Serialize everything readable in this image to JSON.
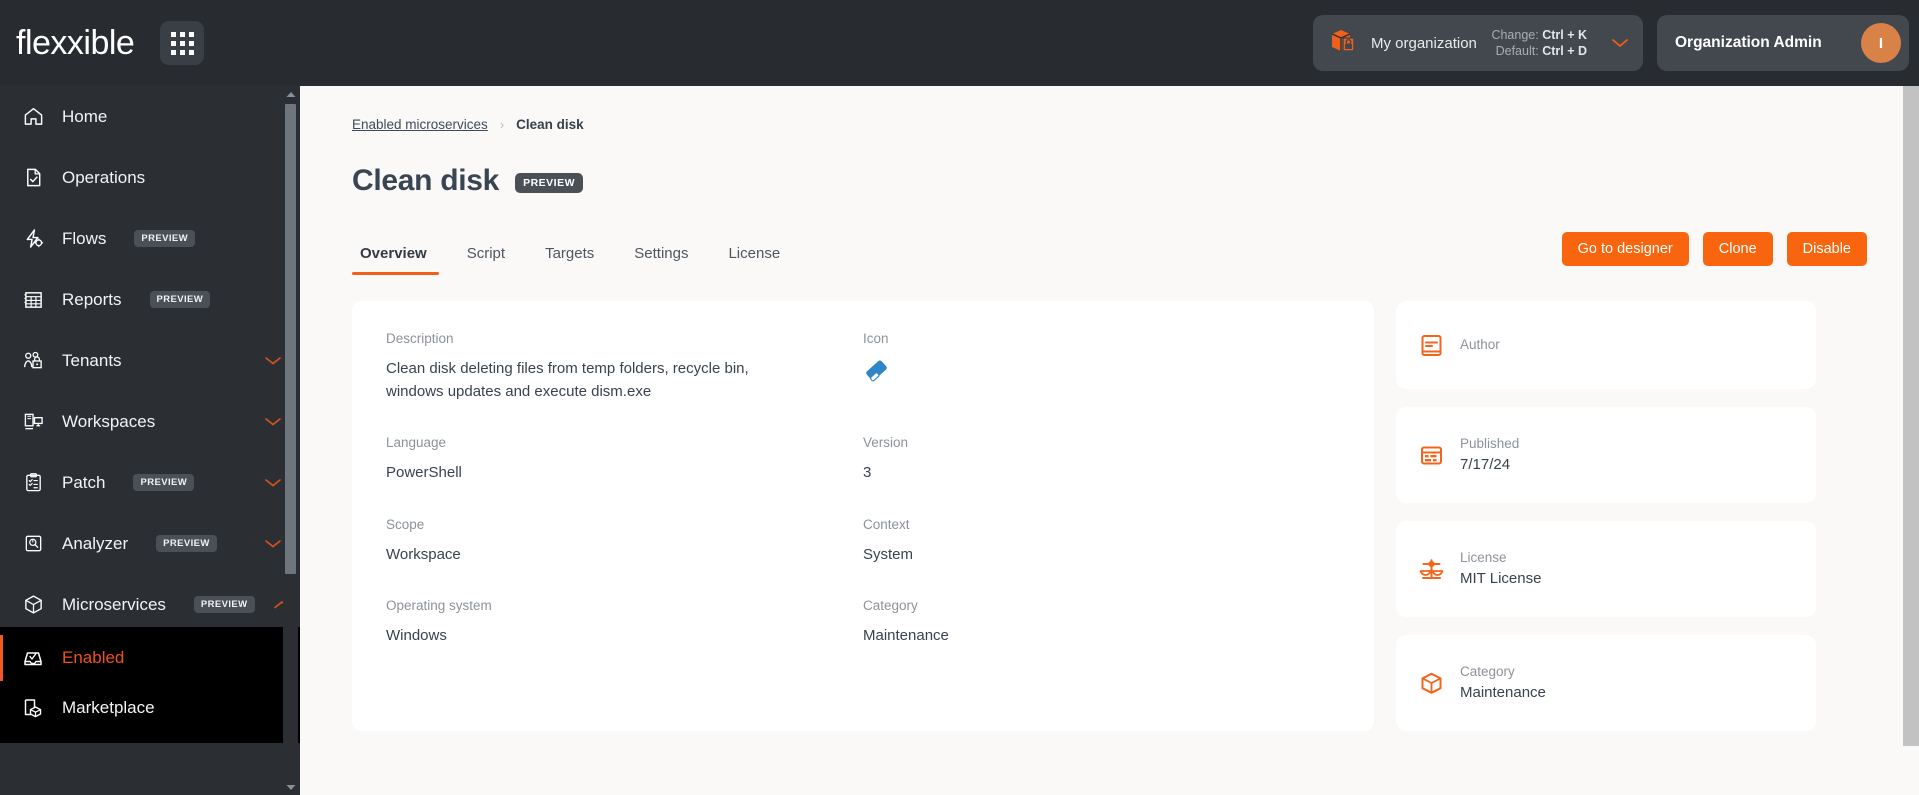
{
  "topbar": {
    "brand": "flexxible",
    "apps_icon": "grid-apps-icon",
    "org": {
      "icon": "package-box-icon",
      "name": "My organization",
      "change_label": "Change:",
      "change_key": "Ctrl + K",
      "default_label": "Default:",
      "default_key": "Ctrl + D",
      "chevron": "chevron-down-icon"
    },
    "user": {
      "role": "Organization Admin",
      "avatar_initial": "I"
    }
  },
  "sidebar": {
    "items": [
      {
        "label": "Home",
        "icon": "home-icon",
        "tag": "",
        "chevron": ""
      },
      {
        "label": "Operations",
        "icon": "document-check-icon",
        "tag": "",
        "chevron": ""
      },
      {
        "label": "Flows",
        "icon": "flow-bolt-icon",
        "tag": "PREVIEW",
        "chevron": ""
      },
      {
        "label": "Reports",
        "icon": "reports-table-icon",
        "tag": "PREVIEW",
        "chevron": ""
      },
      {
        "label": "Tenants",
        "icon": "tenants-users-icon",
        "tag": "",
        "chevron": "chevron-down-icon"
      },
      {
        "label": "Workspaces",
        "icon": "workspaces-icon",
        "tag": "",
        "chevron": "chevron-down-icon"
      },
      {
        "label": "Patch",
        "icon": "patch-clipboard-icon",
        "tag": "PREVIEW",
        "chevron": "chevron-down-icon"
      },
      {
        "label": "Analyzer",
        "icon": "analyzer-disk-icon",
        "tag": "PREVIEW",
        "chevron": "chevron-down-icon"
      },
      {
        "label": "Microservices",
        "icon": "cube-icon",
        "tag": "PREVIEW",
        "chevron": "chevron-up-icon"
      }
    ],
    "submenu": [
      {
        "label": "Enabled",
        "icon": "inbox-check-icon",
        "active": true
      },
      {
        "label": "Marketplace",
        "icon": "page-cube-icon",
        "active": false
      }
    ]
  },
  "main": {
    "breadcrumb": {
      "parent": "Enabled microservices",
      "separator": "›",
      "current": "Clean disk"
    },
    "title": "Clean disk",
    "title_tag": "PREVIEW",
    "tabs": [
      {
        "label": "Overview",
        "active": true
      },
      {
        "label": "Script",
        "active": false
      },
      {
        "label": "Targets",
        "active": false
      },
      {
        "label": "Settings",
        "active": false
      },
      {
        "label": "License",
        "active": false
      }
    ],
    "actions": [
      {
        "label": "Go to designer"
      },
      {
        "label": "Clone"
      },
      {
        "label": "Disable"
      }
    ],
    "fields": [
      {
        "label": "Description",
        "value": "Clean disk deleting files from temp folders, recycle bin, windows updates and execute dism.exe"
      },
      {
        "label": "Icon",
        "value": "",
        "icon": "eraser-icon"
      },
      {
        "label": "Language",
        "value": "PowerShell"
      },
      {
        "label": "Version",
        "value": "3"
      },
      {
        "label": "Scope",
        "value": "Workspace"
      },
      {
        "label": "Context",
        "value": "System"
      },
      {
        "label": "Operating system",
        "value": "Windows"
      },
      {
        "label": "Category",
        "value": "Maintenance"
      }
    ],
    "side_cards": [
      {
        "label": "Author",
        "value": "",
        "icon": "author-book-icon"
      },
      {
        "label": "Published",
        "value": "7/17/24",
        "icon": "calendar-icon"
      },
      {
        "label": "License",
        "value": "MIT License",
        "icon": "scales-icon"
      },
      {
        "label": "Category",
        "value": "Maintenance",
        "icon": "box-icon"
      }
    ]
  },
  "colors": {
    "accent": "#f9650f",
    "accent_alt": "#f1511b",
    "sidebar_bg": "#2b2f33",
    "submenu_bg": "#000000",
    "page_bg": "#faf9f7",
    "card_bg": "#ffffff",
    "avatar_bg": "#d88248",
    "icon_blue": "#2e86c8"
  }
}
